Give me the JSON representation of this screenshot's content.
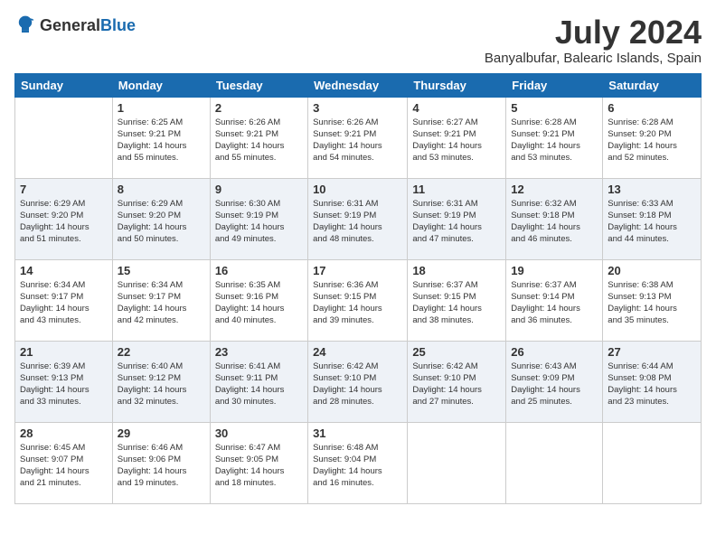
{
  "header": {
    "logo_general": "General",
    "logo_blue": "Blue",
    "month_title": "July 2024",
    "location": "Banyalbufar, Balearic Islands, Spain"
  },
  "weekdays": [
    "Sunday",
    "Monday",
    "Tuesday",
    "Wednesday",
    "Thursday",
    "Friday",
    "Saturday"
  ],
  "weeks": [
    [
      {
        "day": "",
        "info": ""
      },
      {
        "day": "1",
        "info": "Sunrise: 6:25 AM\nSunset: 9:21 PM\nDaylight: 14 hours\nand 55 minutes."
      },
      {
        "day": "2",
        "info": "Sunrise: 6:26 AM\nSunset: 9:21 PM\nDaylight: 14 hours\nand 55 minutes."
      },
      {
        "day": "3",
        "info": "Sunrise: 6:26 AM\nSunset: 9:21 PM\nDaylight: 14 hours\nand 54 minutes."
      },
      {
        "day": "4",
        "info": "Sunrise: 6:27 AM\nSunset: 9:21 PM\nDaylight: 14 hours\nand 53 minutes."
      },
      {
        "day": "5",
        "info": "Sunrise: 6:28 AM\nSunset: 9:21 PM\nDaylight: 14 hours\nand 53 minutes."
      },
      {
        "day": "6",
        "info": "Sunrise: 6:28 AM\nSunset: 9:20 PM\nDaylight: 14 hours\nand 52 minutes."
      }
    ],
    [
      {
        "day": "7",
        "info": "Sunrise: 6:29 AM\nSunset: 9:20 PM\nDaylight: 14 hours\nand 51 minutes."
      },
      {
        "day": "8",
        "info": "Sunrise: 6:29 AM\nSunset: 9:20 PM\nDaylight: 14 hours\nand 50 minutes."
      },
      {
        "day": "9",
        "info": "Sunrise: 6:30 AM\nSunset: 9:19 PM\nDaylight: 14 hours\nand 49 minutes."
      },
      {
        "day": "10",
        "info": "Sunrise: 6:31 AM\nSunset: 9:19 PM\nDaylight: 14 hours\nand 48 minutes."
      },
      {
        "day": "11",
        "info": "Sunrise: 6:31 AM\nSunset: 9:19 PM\nDaylight: 14 hours\nand 47 minutes."
      },
      {
        "day": "12",
        "info": "Sunrise: 6:32 AM\nSunset: 9:18 PM\nDaylight: 14 hours\nand 46 minutes."
      },
      {
        "day": "13",
        "info": "Sunrise: 6:33 AM\nSunset: 9:18 PM\nDaylight: 14 hours\nand 44 minutes."
      }
    ],
    [
      {
        "day": "14",
        "info": "Sunrise: 6:34 AM\nSunset: 9:17 PM\nDaylight: 14 hours\nand 43 minutes."
      },
      {
        "day": "15",
        "info": "Sunrise: 6:34 AM\nSunset: 9:17 PM\nDaylight: 14 hours\nand 42 minutes."
      },
      {
        "day": "16",
        "info": "Sunrise: 6:35 AM\nSunset: 9:16 PM\nDaylight: 14 hours\nand 40 minutes."
      },
      {
        "day": "17",
        "info": "Sunrise: 6:36 AM\nSunset: 9:15 PM\nDaylight: 14 hours\nand 39 minutes."
      },
      {
        "day": "18",
        "info": "Sunrise: 6:37 AM\nSunset: 9:15 PM\nDaylight: 14 hours\nand 38 minutes."
      },
      {
        "day": "19",
        "info": "Sunrise: 6:37 AM\nSunset: 9:14 PM\nDaylight: 14 hours\nand 36 minutes."
      },
      {
        "day": "20",
        "info": "Sunrise: 6:38 AM\nSunset: 9:13 PM\nDaylight: 14 hours\nand 35 minutes."
      }
    ],
    [
      {
        "day": "21",
        "info": "Sunrise: 6:39 AM\nSunset: 9:13 PM\nDaylight: 14 hours\nand 33 minutes."
      },
      {
        "day": "22",
        "info": "Sunrise: 6:40 AM\nSunset: 9:12 PM\nDaylight: 14 hours\nand 32 minutes."
      },
      {
        "day": "23",
        "info": "Sunrise: 6:41 AM\nSunset: 9:11 PM\nDaylight: 14 hours\nand 30 minutes."
      },
      {
        "day": "24",
        "info": "Sunrise: 6:42 AM\nSunset: 9:10 PM\nDaylight: 14 hours\nand 28 minutes."
      },
      {
        "day": "25",
        "info": "Sunrise: 6:42 AM\nSunset: 9:10 PM\nDaylight: 14 hours\nand 27 minutes."
      },
      {
        "day": "26",
        "info": "Sunrise: 6:43 AM\nSunset: 9:09 PM\nDaylight: 14 hours\nand 25 minutes."
      },
      {
        "day": "27",
        "info": "Sunrise: 6:44 AM\nSunset: 9:08 PM\nDaylight: 14 hours\nand 23 minutes."
      }
    ],
    [
      {
        "day": "28",
        "info": "Sunrise: 6:45 AM\nSunset: 9:07 PM\nDaylight: 14 hours\nand 21 minutes."
      },
      {
        "day": "29",
        "info": "Sunrise: 6:46 AM\nSunset: 9:06 PM\nDaylight: 14 hours\nand 19 minutes."
      },
      {
        "day": "30",
        "info": "Sunrise: 6:47 AM\nSunset: 9:05 PM\nDaylight: 14 hours\nand 18 minutes."
      },
      {
        "day": "31",
        "info": "Sunrise: 6:48 AM\nSunset: 9:04 PM\nDaylight: 14 hours\nand 16 minutes."
      },
      {
        "day": "",
        "info": ""
      },
      {
        "day": "",
        "info": ""
      },
      {
        "day": "",
        "info": ""
      }
    ]
  ]
}
